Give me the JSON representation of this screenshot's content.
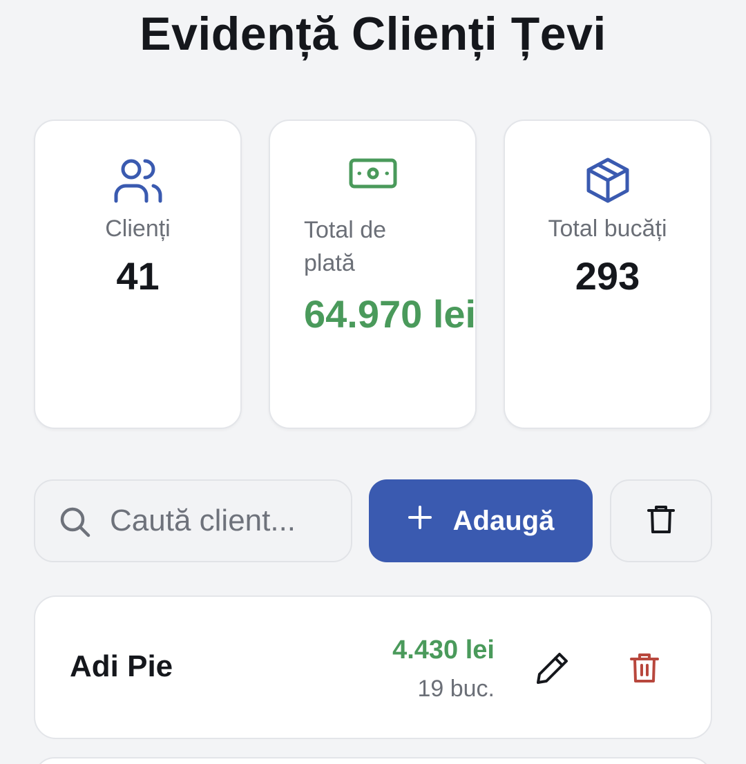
{
  "header": {
    "title": "Evidență Clienți Țevi"
  },
  "stats": [
    {
      "icon": "users-icon",
      "label": "Clienți",
      "value": "41"
    },
    {
      "icon": "banknote-icon",
      "label": "Total de plată",
      "value": "64.970 lei"
    },
    {
      "icon": "package-icon",
      "label": "Total bucăți",
      "value": "293"
    }
  ],
  "toolbar": {
    "search_placeholder": "Caută client...",
    "add_label": "Adaugă",
    "add_icon": "plus-icon",
    "clear_icon": "trash-icon"
  },
  "clients": [
    {
      "name": "Adi Pie",
      "total": "4.430 lei",
      "quantity": "19 buc."
    }
  ],
  "colors": {
    "accent": "#3a5ab0",
    "money": "#4a9a5b",
    "danger": "#b8473d",
    "background": "#f3f4f6"
  }
}
